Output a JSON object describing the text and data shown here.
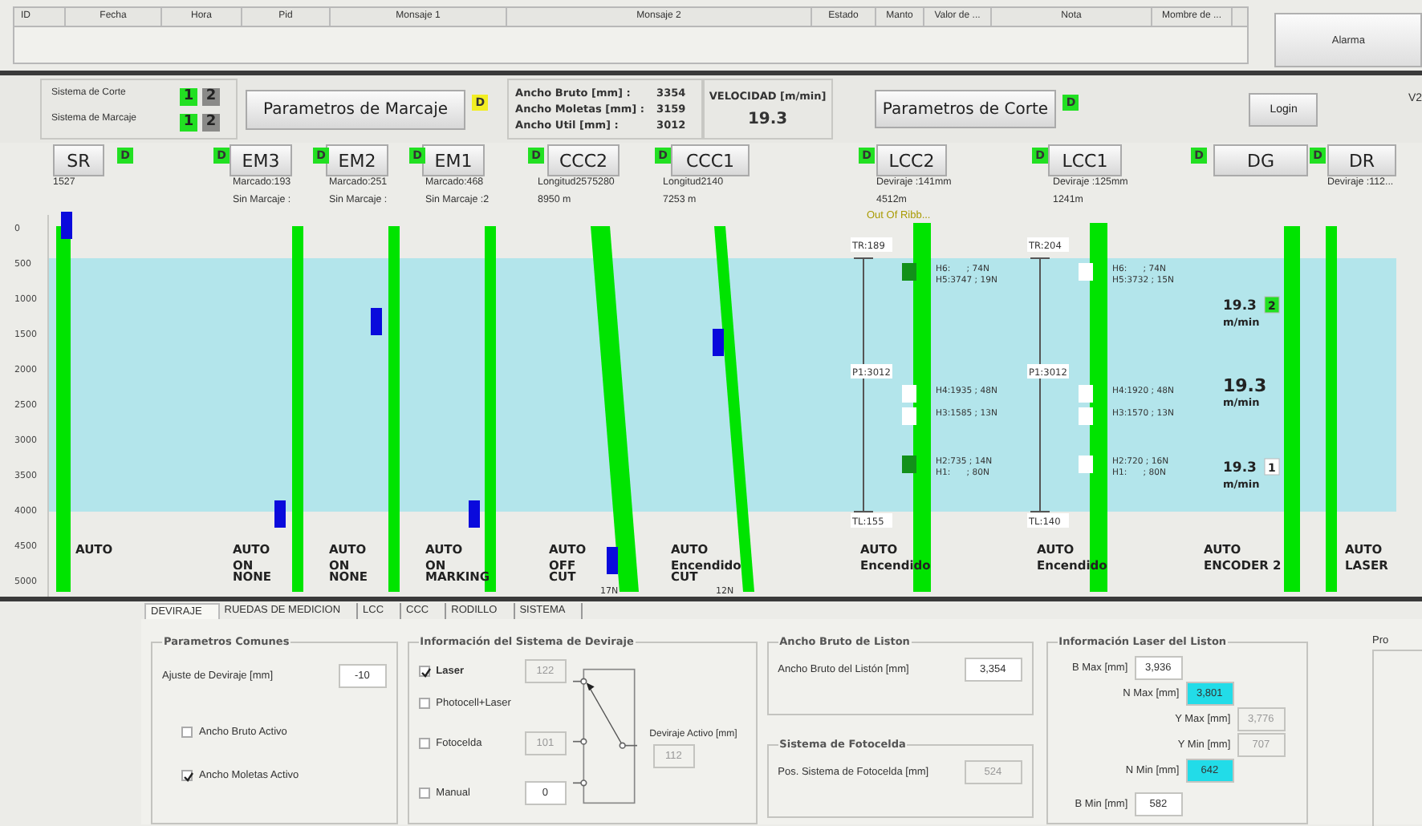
{
  "alarm_table": {
    "columns": [
      "ID",
      "Fecha",
      "Hora",
      "Pid",
      "Monsaje 1",
      "Monsaje 2",
      "Estado",
      "Manto",
      "Valor de ...",
      "Nota",
      "Mombre de ..."
    ]
  },
  "alarm_button": "Alarma",
  "systems": [
    {
      "label": "Sistema de Corte",
      "options": [
        {
          "label": "1",
          "selected": true
        },
        {
          "label": "2",
          "selected": false
        }
      ]
    },
    {
      "label": "Sistema de Marcaje",
      "options": [
        {
          "label": "1",
          "selected": true
        },
        {
          "label": "2",
          "selected": false
        }
      ]
    }
  ],
  "marking_params": {
    "label": "Parametros de Marcaje",
    "badge": "D",
    "badge_warning": true
  },
  "widths": [
    {
      "label": "Ancho Bruto [mm] :",
      "value": "3354"
    },
    {
      "label": "Ancho Moletas [mm] :",
      "value": "3159"
    },
    {
      "label": "Ancho Util [mm] :",
      "value": "3012"
    }
  ],
  "speed": {
    "label": "VELOCIDAD [m/min]",
    "value": "19.3"
  },
  "cut_params": {
    "label": "Parametros de Corte",
    "badge": "D",
    "badge_warning": false
  },
  "login": "Login",
  "version": "V2",
  "axis_labels": [
    "0",
    "500",
    "1000",
    "1500",
    "2000",
    "2500",
    "3000",
    "3500",
    "4000",
    "4500",
    "5000"
  ],
  "stations": [
    {
      "name": "SR",
      "badge": "D",
      "badge_warning": false,
      "info": [
        "1527"
      ],
      "status": [
        "AUTO"
      ],
      "marker": true,
      "skewed": false
    },
    {
      "name": "EM3",
      "badge": "D",
      "badge_warning": false,
      "info": [
        "Marcado:193",
        "Sin Marcaje :"
      ],
      "status": [
        "AUTO",
        "ON",
        "NONE"
      ],
      "marker": true,
      "skewed": false
    },
    {
      "name": "EM2",
      "badge": "D",
      "badge_warning": false,
      "info": [
        "Marcado:251",
        "Sin Marcaje :"
      ],
      "status": [
        "AUTO",
        "ON",
        "NONE"
      ],
      "marker": true,
      "skewed": false
    },
    {
      "name": "EM1",
      "badge": "D",
      "badge_warning": false,
      "info": [
        "Marcado:468",
        "Sin Marcaje :2"
      ],
      "status": [
        "AUTO",
        "ON",
        "MARKING"
      ],
      "marker": true,
      "skewed": false
    },
    {
      "name": "CCC2",
      "badge": "D",
      "badge_warning": false,
      "info": [
        "Longitud2575280",
        "8950 m"
      ],
      "status": [
        "AUTO",
        "OFF",
        "CUT"
      ],
      "force": "17N",
      "marker": true,
      "skewed": true
    },
    {
      "name": "CCC1",
      "badge": "D",
      "badge_warning": false,
      "info": [
        "Longitud2140",
        "7253 m"
      ],
      "status": [
        "AUTO",
        "Encendido",
        "CUT"
      ],
      "force": "12N",
      "marker": true,
      "skewed": true
    },
    {
      "name": "LCC2",
      "badge": "D",
      "badge_warning": false,
      "info": [
        "Deviraje :141mm",
        "4512m"
      ],
      "warning": "Out Of Ribb...",
      "status": [
        "AUTO",
        "Encendido"
      ],
      "skewed": false,
      "gauge": {
        "top": "TR:189",
        "middle": "P1:3012",
        "bottom": "TL:155"
      },
      "heads": [
        {
          "lines": [
            "H6:      ; 74N",
            "H5:3747 ; 19N"
          ],
          "active": true
        },
        {
          "lines": [
            "H4:1935 ; 48N"
          ],
          "active": false
        },
        {
          "lines": [
            "H3:1585 ; 13N"
          ],
          "active": false
        },
        {
          "lines": [
            "H2:735 ; 14N",
            "H1:      ; 80N"
          ],
          "active": true
        }
      ]
    },
    {
      "name": "LCC1",
      "badge": "D",
      "badge_warning": false,
      "info": [
        "Deviraje :125mm",
        "1241m"
      ],
      "status": [
        "AUTO",
        "Encendido"
      ],
      "skewed": false,
      "gauge": {
        "top": "TR:204",
        "middle": "P1:3012",
        "bottom": "TL:140"
      },
      "heads": [
        {
          "lines": [
            "H6:      ; 74N",
            "H5:3732 ; 15N"
          ],
          "active": false
        },
        {
          "lines": [
            "H4:1920 ; 48N"
          ],
          "active": false
        },
        {
          "lines": [
            "H3:1570 ; 13N"
          ],
          "active": false
        },
        {
          "lines": [
            "H2:720 ; 16N",
            "H1:      ; 80N"
          ],
          "active": false
        }
      ]
    },
    {
      "name": "DG",
      "badge": "D",
      "badge_warning": false,
      "status": [
        "AUTO",
        "ENCODER 2"
      ],
      "skewed": false,
      "speeds": [
        {
          "value": "19.3",
          "unit": "m/min",
          "tag": "2",
          "tag_active": true
        },
        {
          "value": "19.3",
          "unit": "m/min"
        },
        {
          "value": "19.3",
          "unit": "m/min",
          "tag": "1",
          "tag_active": false
        }
      ]
    },
    {
      "name": "DR",
      "badge": "D",
      "badge_warning": false,
      "info": [
        "Deviraje :112..."
      ],
      "status": [
        "AUTO",
        "LASER"
      ],
      "skewed": false
    }
  ],
  "settings": {
    "tabs": [
      {
        "label": "DEVIRAJE",
        "selected": true
      },
      {
        "label": "RUEDAS DE MEDICION",
        "selected": false
      },
      {
        "label": "LCC",
        "selected": false
      },
      {
        "label": "CCC",
        "selected": false
      },
      {
        "label": "RODILLO",
        "selected": false
      },
      {
        "label": "SISTEMA",
        "selected": false
      }
    ],
    "common": {
      "title": "Parametros Comunes",
      "field_label": "Ajuste de Deviraje [mm]",
      "field_value": "-10",
      "checkboxes": [
        {
          "label": "Ancho Bruto Activo",
          "checked": false
        },
        {
          "label": "Ancho Moletas Activo",
          "checked": true
        }
      ]
    },
    "deviraje": {
      "title": "Información del Sistema de Deviraje",
      "options": [
        {
          "label": "Laser",
          "checked": true,
          "value": "122",
          "disabled": true,
          "selected": true
        },
        {
          "label": "Photocell+Laser",
          "checked": false,
          "selected": false
        },
        {
          "label": "Fotocelda",
          "checked": false,
          "value": "101",
          "disabled": true,
          "selected": false
        },
        {
          "label": "Manual",
          "checked": false,
          "value": "0",
          "disabled": false,
          "selected": false
        }
      ],
      "output_label": "Deviraje Activo [mm]",
      "output_value": "112"
    },
    "gross": {
      "title": "Ancho Bruto de Liston",
      "field_label": "Ancho Bruto del Listón [mm]",
      "field_value": "3,354"
    },
    "photocell": {
      "title": "Sistema de Fotocelda",
      "field_label": "Pos. Sistema de Fotocelda [mm]",
      "field_value": "524",
      "disabled": true
    },
    "laser": {
      "title": "Información Laser del Liston",
      "rows": [
        {
          "label": "B Max [mm]",
          "value": "3,936",
          "highlighted": false,
          "disabled": false
        },
        {
          "label": "N Max [mm]",
          "value": "3,801",
          "highlighted": true,
          "disabled": false
        },
        {
          "label": "Y Max [mm]",
          "value": "3,776",
          "highlighted": false,
          "disabled": true
        },
        {
          "label": "Y Min [mm]",
          "value": "707",
          "highlighted": false,
          "disabled": true
        },
        {
          "label": "N Min [mm]",
          "value": "642",
          "highlighted": true,
          "disabled": false
        },
        {
          "label": "B Min [mm]",
          "value": "582",
          "highlighted": false,
          "disabled": false
        }
      ]
    },
    "side_label": "Pro"
  }
}
